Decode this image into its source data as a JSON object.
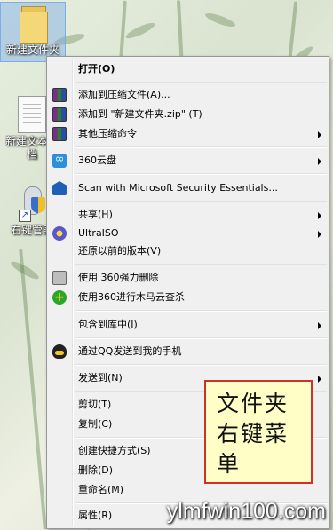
{
  "desktop": {
    "icons": [
      {
        "label": "新建文件夹"
      },
      {
        "label": "新建文本文档"
      },
      {
        "label": "右键管家"
      }
    ]
  },
  "context_menu": {
    "items": [
      {
        "label": "打开(O)",
        "icon": "none",
        "submenu": false,
        "bold": true
      },
      {
        "label": "添加到压缩文件(A)...",
        "icon": "winrar-icon",
        "submenu": false
      },
      {
        "label": "添加到 \"新建文件夹.zip\" (T)",
        "icon": "winrar-icon",
        "submenu": false
      },
      {
        "label": "其他压缩命令",
        "icon": "winrar-icon",
        "submenu": true
      },
      {
        "label": "360云盘",
        "icon": "cloud-icon",
        "submenu": true
      },
      {
        "label": "Scan with Microsoft Security Essentials...",
        "icon": "security-icon",
        "submenu": false
      },
      {
        "label": "共享(H)",
        "icon": "none",
        "submenu": true
      },
      {
        "label": "UltraISO",
        "icon": "ultraiso-icon",
        "submenu": true
      },
      {
        "label": "还原以前的版本(V)",
        "icon": "none",
        "submenu": false
      },
      {
        "label": "使用 360强力删除",
        "icon": "shredder-icon",
        "submenu": false
      },
      {
        "label": "使用360进行木马云查杀",
        "icon": "360-antivirus-icon",
        "submenu": false
      },
      {
        "label": "包含到库中(I)",
        "icon": "none",
        "submenu": true
      },
      {
        "label": "通过QQ发送到我的手机",
        "icon": "qq-icon",
        "submenu": false
      },
      {
        "label": "发送到(N)",
        "icon": "none",
        "submenu": true
      },
      {
        "label": "剪切(T)",
        "icon": "none",
        "submenu": false
      },
      {
        "label": "复制(C)",
        "icon": "none",
        "submenu": false
      },
      {
        "label": "创建快捷方式(S)",
        "icon": "none",
        "submenu": false
      },
      {
        "label": "删除(D)",
        "icon": "none",
        "submenu": false
      },
      {
        "label": "重命名(M)",
        "icon": "none",
        "submenu": false
      },
      {
        "label": "属性(R)",
        "icon": "none",
        "submenu": false
      }
    ]
  },
  "annotation": {
    "text": "文件夹右键菜单",
    "border_color": "#d0302a",
    "background": "#fffec7"
  },
  "watermark": {
    "text": "ylmfwin100.com"
  }
}
